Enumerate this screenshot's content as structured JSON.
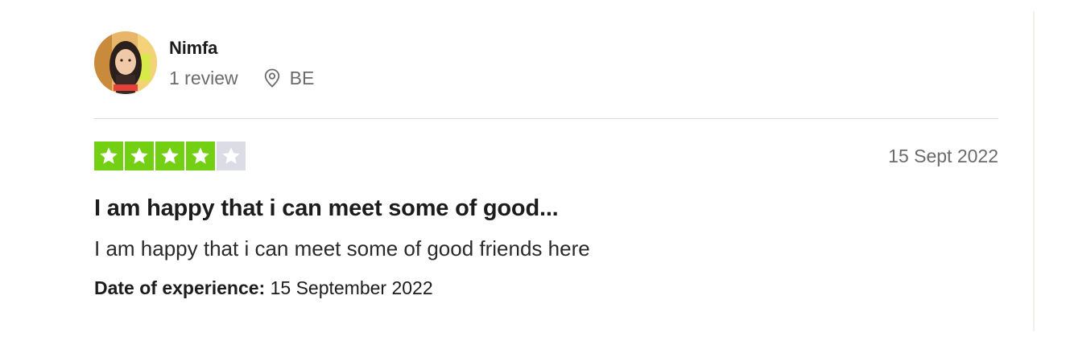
{
  "reviewer": {
    "name": "Nimfa",
    "review_count": "1 review",
    "location": "BE",
    "avatar_icon": "user-avatar-photo",
    "location_icon": "map-pin-icon"
  },
  "review": {
    "rating": 4,
    "max_rating": 5,
    "star_color": "#73cf11",
    "empty_star_color": "#dcdce6",
    "date": "15 Sept 2022",
    "title": "I am happy that i can meet some of good...",
    "body": "I am happy that i can meet some of good friends here",
    "experience_label": "Date of experience:",
    "experience_date": "15 September 2022"
  }
}
